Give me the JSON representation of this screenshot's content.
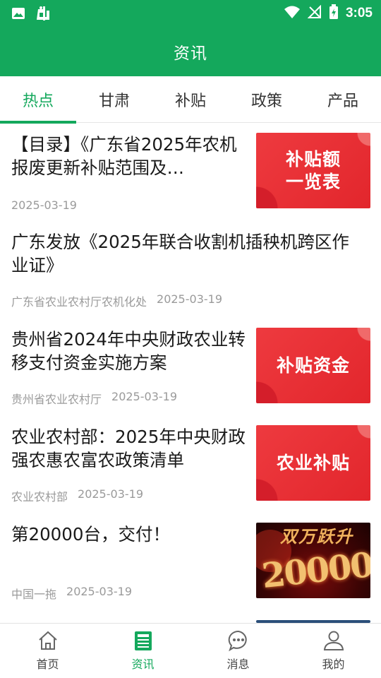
{
  "status_bar": {
    "time": "3:05"
  },
  "app_bar": {
    "title": "资讯"
  },
  "tabs": [
    {
      "label": "热点",
      "active": true
    },
    {
      "label": "甘肃",
      "active": false
    },
    {
      "label": "补贴",
      "active": false
    },
    {
      "label": "政策",
      "active": false
    },
    {
      "label": "产品",
      "active": false
    }
  ],
  "feed": [
    {
      "title": "【目录】《广东省2025年农机报废更新补贴范围及…",
      "source": "",
      "date": "2025-03-19",
      "thumb_text": "补贴额\n一览表"
    },
    {
      "title": "广东发放《2025年联合收割机插秧机跨区作业证》",
      "source": "广东省农业农村厅农机化处",
      "date": "2025-03-19"
    },
    {
      "title": "贵州省2024年中央财政农业转移支付资金实施方案",
      "source": "贵州省农业农村厅",
      "date": "2025-03-19",
      "thumb_text": "补贴资金"
    },
    {
      "title": "农业农村部：2025年中央财政强农惠农富农政策清单",
      "source": "农业农村部",
      "date": "2025-03-19",
      "thumb_text": "农业补贴"
    },
    {
      "title": "第20000台，交付！",
      "source": "中国一拖",
      "date": "2025-03-19",
      "thumb_text_top": "双万跃升",
      "thumb_text_big": "20000"
    }
  ],
  "bottom_nav": [
    {
      "label": "首页",
      "icon": "home-icon",
      "active": false
    },
    {
      "label": "资讯",
      "icon": "news-icon",
      "active": true
    },
    {
      "label": "消息",
      "icon": "chat-icon",
      "active": false
    },
    {
      "label": "我的",
      "icon": "user-icon",
      "active": false
    }
  ],
  "colors": {
    "brand": "#14a85c",
    "thumb_red": "#e8282e",
    "meta_gray": "#9a9a9a"
  }
}
